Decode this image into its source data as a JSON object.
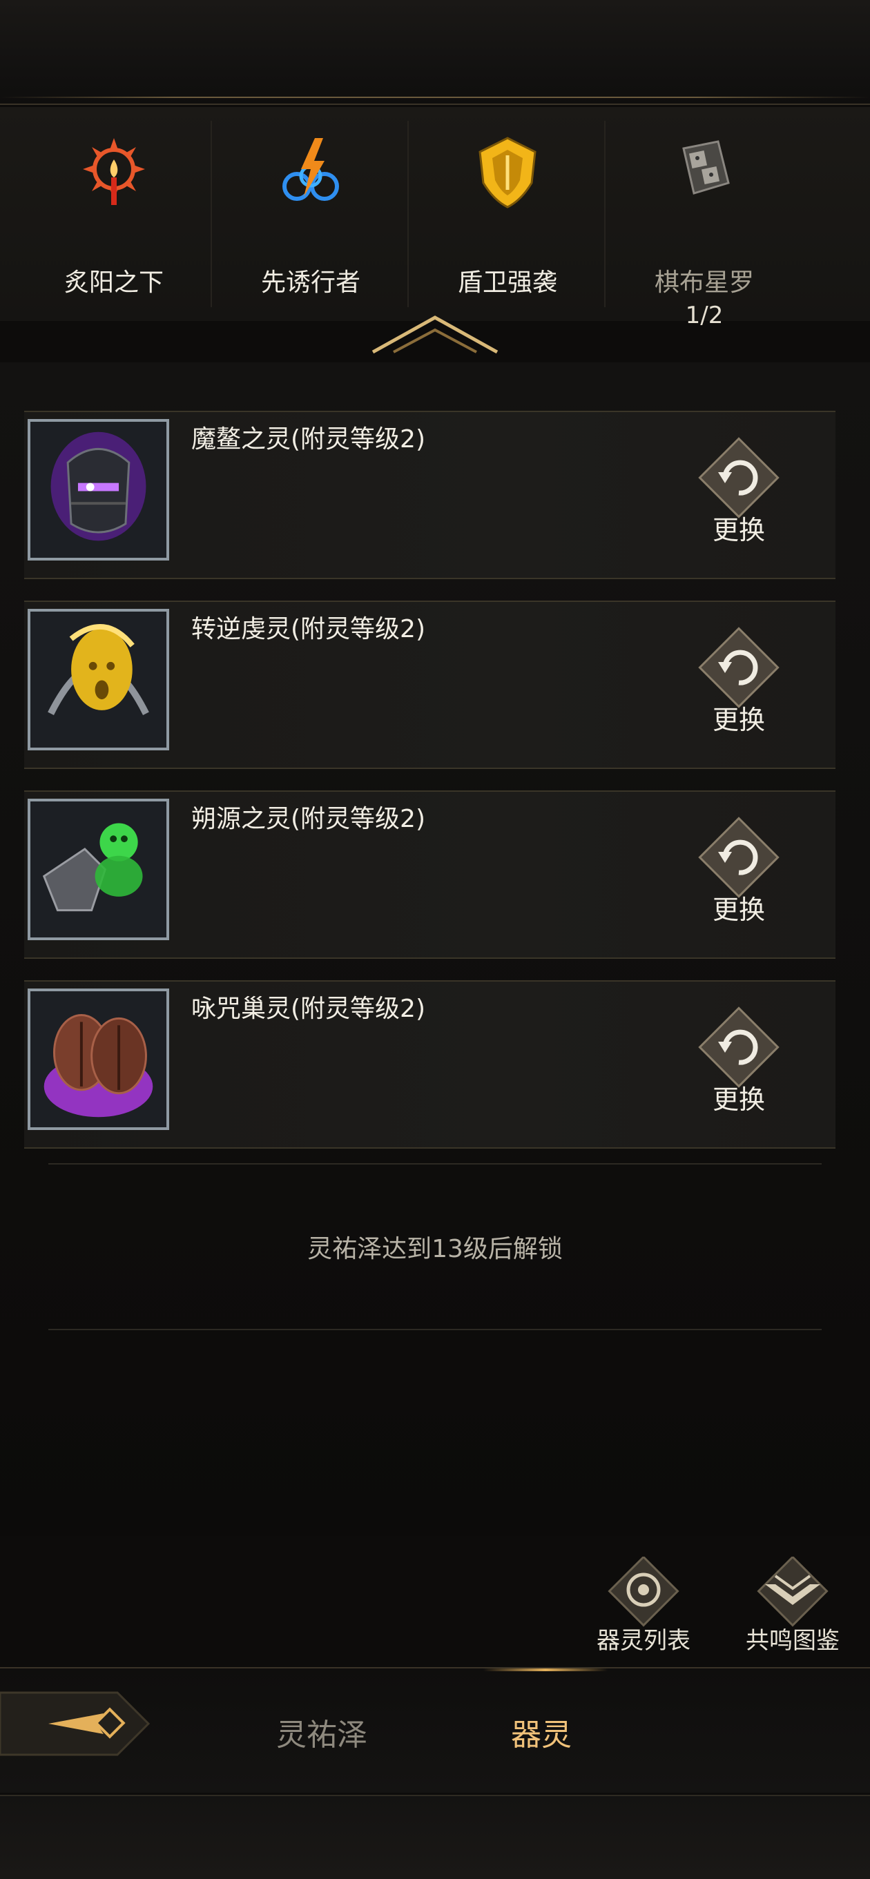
{
  "tabs": [
    {
      "label": "炙阳之下",
      "icon": "sun-flame-icon",
      "color": "#e8572a"
    },
    {
      "label": "先诱行者",
      "icon": "lightning-swirl-icon",
      "color": "#2f8ff0"
    },
    {
      "label": "盾卫强袭",
      "icon": "golden-shield-icon",
      "color": "#f2b518"
    },
    {
      "label": "棋布星罗",
      "sub": "1/2",
      "icon": "scroll-dice-icon",
      "color": "#8a8680"
    }
  ],
  "spirits": [
    {
      "name": "魔鳌之灵(附灵等级2)",
      "swap_label": "更换",
      "icon": "dark-knight-helm-icon",
      "accent": "#9b3cf0"
    },
    {
      "name": "转逆虔灵(附灵等级2)",
      "swap_label": "更换",
      "icon": "golden-face-icon",
      "accent": "#e2b41c"
    },
    {
      "name": "朔源之灵(附灵等级2)",
      "swap_label": "更换",
      "icon": "green-spirit-armor-icon",
      "accent": "#3dd64a"
    },
    {
      "name": "咏咒巢灵(附灵等级2)",
      "swap_label": "更换",
      "icon": "purple-cocoon-icon",
      "accent": "#b13ae8"
    }
  ],
  "locked_message": "灵祐泽达到13级后解锁",
  "corner_buttons": [
    {
      "label": "器灵列表",
      "icon": "spirit-list-icon"
    },
    {
      "label": "共鸣图鉴",
      "icon": "resonance-codex-icon"
    }
  ],
  "bottom_tabs": {
    "back_icon": "back-arrow-icon",
    "tab1": "灵祐泽",
    "tab2": "器灵"
  }
}
